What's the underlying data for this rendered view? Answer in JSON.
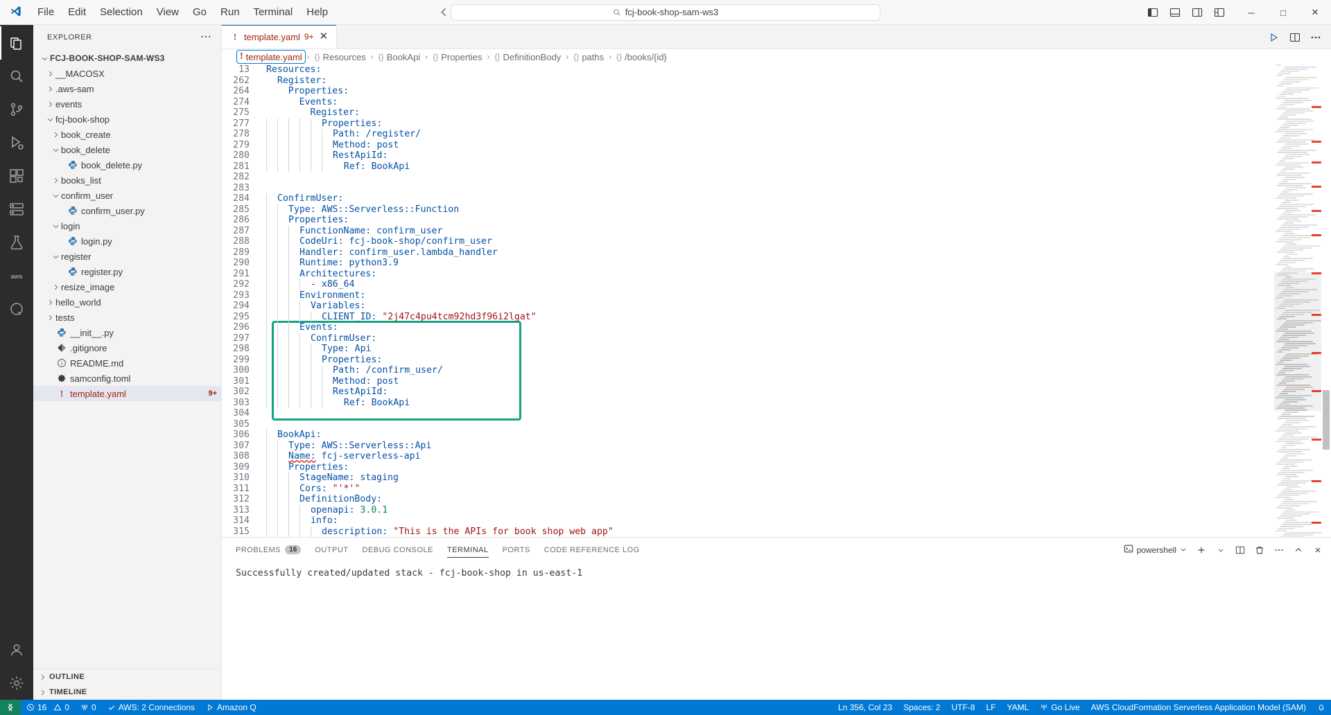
{
  "titlebar": {
    "logo_icon": "vscode-logo-icon",
    "menus": [
      "File",
      "Edit",
      "Selection",
      "View",
      "Go",
      "Run",
      "Terminal",
      "Help"
    ],
    "nav_back_icon": "arrow-left-icon",
    "nav_forward_icon": "arrow-right-icon",
    "command_center": {
      "icon": "search-icon",
      "text": "fcj-book-shop-sam-ws3"
    },
    "layout_icons": [
      "toggle-primary-sidebar-icon",
      "toggle-panel-icon",
      "toggle-secondary-sidebar-icon",
      "customize-layout-icon"
    ],
    "window_controls": {
      "minimize": "─",
      "maximize": "□",
      "close": "✕"
    }
  },
  "activitybar": {
    "items": [
      {
        "name": "explorer-icon",
        "active": true
      },
      {
        "name": "search-icon",
        "active": false
      },
      {
        "name": "source-control-icon",
        "active": false
      },
      {
        "name": "run-debug-icon",
        "active": false
      },
      {
        "name": "extensions-icon",
        "active": false
      },
      {
        "name": "remote-explorer-icon",
        "active": false
      },
      {
        "name": "testing-icon",
        "active": false
      },
      {
        "name": "aws-toolkit-icon",
        "active": false
      },
      {
        "name": "amazon-q-icon",
        "active": false
      }
    ],
    "bottom": [
      {
        "name": "accounts-icon"
      },
      {
        "name": "settings-gear-icon"
      }
    ]
  },
  "sidebar": {
    "title": "EXPLORER",
    "more_actions_icon": "ellipsis-icon",
    "tree": [
      {
        "label": "FCJ-BOOK-SHOP-SAM-WS3",
        "depth": 0,
        "type": "root",
        "state": "expanded",
        "icon": ""
      },
      {
        "label": "__MACOSX",
        "depth": 1,
        "type": "folder",
        "state": "collapsed",
        "icon": ""
      },
      {
        "label": ".aws-sam",
        "depth": 1,
        "type": "folder",
        "state": "collapsed",
        "icon": ""
      },
      {
        "label": "events",
        "depth": 1,
        "type": "folder",
        "state": "collapsed",
        "icon": ""
      },
      {
        "label": "fcj-book-shop",
        "depth": 1,
        "type": "folder",
        "state": "expanded",
        "icon": ""
      },
      {
        "label": "book_create",
        "depth": 2,
        "type": "folder",
        "state": "collapsed",
        "icon": ""
      },
      {
        "label": "book_delete",
        "depth": 2,
        "type": "folder",
        "state": "expanded",
        "icon": ""
      },
      {
        "label": "book_delete.py",
        "depth": 3,
        "type": "file",
        "state": "none",
        "icon": "python-icon"
      },
      {
        "label": "books_list",
        "depth": 2,
        "type": "folder",
        "state": "collapsed",
        "icon": ""
      },
      {
        "label": "confirm_user",
        "depth": 2,
        "type": "folder",
        "state": "expanded",
        "icon": ""
      },
      {
        "label": "confirm_user.py",
        "depth": 3,
        "type": "file",
        "state": "none",
        "icon": "python-icon"
      },
      {
        "label": "login",
        "depth": 2,
        "type": "folder",
        "state": "expanded",
        "icon": ""
      },
      {
        "label": "login.py",
        "depth": 3,
        "type": "file",
        "state": "none",
        "icon": "python-icon"
      },
      {
        "label": "register",
        "depth": 2,
        "type": "folder",
        "state": "expanded",
        "icon": ""
      },
      {
        "label": "register.py",
        "depth": 3,
        "type": "file",
        "state": "none",
        "icon": "python-icon"
      },
      {
        "label": "resize_image",
        "depth": 2,
        "type": "folder",
        "state": "collapsed",
        "icon": ""
      },
      {
        "label": "hello_world",
        "depth": 1,
        "type": "folder",
        "state": "collapsed",
        "icon": ""
      },
      {
        "label": "tests",
        "depth": 1,
        "type": "folder",
        "state": "collapsed",
        "icon": ""
      },
      {
        "label": "__init__.py",
        "depth": 1,
        "type": "file",
        "state": "none",
        "icon": "python-icon"
      },
      {
        "label": ".gitignore",
        "depth": 1,
        "type": "file",
        "state": "none",
        "icon": "git-icon"
      },
      {
        "label": "README.md",
        "depth": 1,
        "type": "file",
        "state": "none",
        "icon": "info-icon"
      },
      {
        "label": "samconfig.toml",
        "depth": 1,
        "type": "file",
        "state": "none",
        "icon": "gear-icon"
      },
      {
        "label": "template.yaml",
        "depth": 1,
        "type": "file",
        "state": "none",
        "icon": "warning-icon",
        "selected": true,
        "error": true,
        "badge": "9+"
      }
    ],
    "sections": [
      {
        "label": "OUTLINE",
        "state": "collapsed"
      },
      {
        "label": "TIMELINE",
        "state": "collapsed"
      }
    ]
  },
  "editor": {
    "tab": {
      "icon": "warning-icon",
      "name": "template.yaml",
      "badge": "9+",
      "close": "✕"
    },
    "tab_actions": [
      "split-editor-icon",
      "more-actions-icon",
      "run-icon"
    ],
    "breadcrumb": [
      {
        "sym": "!",
        "text": "template.yaml",
        "boxed": true,
        "error": true
      },
      {
        "sym": "{}",
        "text": "Resources"
      },
      {
        "sym": "{}",
        "text": "BookApi"
      },
      {
        "sym": "{}",
        "text": "Properties"
      },
      {
        "sym": "{}",
        "text": "DefinitionBody"
      },
      {
        "sym": "{}",
        "text": "paths"
      },
      {
        "sym": "{}",
        "text": "/books/{id}"
      }
    ],
    "highlight_color": "#13a383",
    "lines": [
      {
        "n": "13",
        "ind": 0,
        "tokens": [
          {
            "t": "Resources:",
            "c": "k"
          }
        ]
      },
      {
        "n": "262",
        "ind": 0,
        "tokens": [
          {
            "t": "  Register:",
            "c": "k"
          }
        ]
      },
      {
        "n": "264",
        "ind": 0,
        "tokens": [
          {
            "t": "    Properties:",
            "c": "k"
          }
        ]
      },
      {
        "n": "274",
        "ind": 0,
        "tokens": [
          {
            "t": "      Events:",
            "c": "k"
          }
        ]
      },
      {
        "n": "275",
        "ind": 0,
        "tokens": [
          {
            "t": "        Register:",
            "c": "k"
          }
        ]
      },
      {
        "n": "277",
        "ind": 5,
        "tokens": [
          {
            "t": "          Properties:",
            "c": "k"
          }
        ]
      },
      {
        "n": "278",
        "ind": 6,
        "tokens": [
          {
            "t": "            Path:",
            "c": "k"
          },
          {
            "t": " /register/",
            "c": "v"
          }
        ]
      },
      {
        "n": "279",
        "ind": 6,
        "tokens": [
          {
            "t": "            Method:",
            "c": "k"
          },
          {
            "t": " post",
            "c": "v"
          }
        ]
      },
      {
        "n": "280",
        "ind": 6,
        "tokens": [
          {
            "t": "            RestApiId:",
            "c": "k"
          }
        ]
      },
      {
        "n": "281",
        "ind": 6,
        "tokens": [
          {
            "t": "              Ref:",
            "c": "k"
          },
          {
            "t": " BookApi",
            "c": "v"
          }
        ]
      },
      {
        "n": "282",
        "ind": 0,
        "tokens": []
      },
      {
        "n": "283",
        "ind": 0,
        "tokens": []
      },
      {
        "n": "284",
        "ind": 1,
        "tokens": [
          {
            "t": "  ConfirmUser:",
            "c": "k"
          }
        ]
      },
      {
        "n": "285",
        "ind": 2,
        "tokens": [
          {
            "t": "    Type:",
            "c": "k"
          },
          {
            "t": " AWS::Serverless::Function",
            "c": "v"
          }
        ]
      },
      {
        "n": "286",
        "ind": 2,
        "tokens": [
          {
            "t": "    Properties:",
            "c": "k"
          }
        ]
      },
      {
        "n": "287",
        "ind": 3,
        "tokens": [
          {
            "t": "      FunctionName:",
            "c": "k"
          },
          {
            "t": " confirm_user",
            "c": "v"
          }
        ]
      },
      {
        "n": "288",
        "ind": 3,
        "tokens": [
          {
            "t": "      CodeUri:",
            "c": "k"
          },
          {
            "t": " fcj-book-shop/confirm_user",
            "c": "v"
          }
        ]
      },
      {
        "n": "289",
        "ind": 3,
        "tokens": [
          {
            "t": "      Handler:",
            "c": "k"
          },
          {
            "t": " confirm_user.lambda_handler",
            "c": "v"
          }
        ]
      },
      {
        "n": "290",
        "ind": 3,
        "tokens": [
          {
            "t": "      Runtime:",
            "c": "k"
          },
          {
            "t": " python3.9",
            "c": "v"
          }
        ]
      },
      {
        "n": "291",
        "ind": 3,
        "tokens": [
          {
            "t": "      Architectures:",
            "c": "k"
          }
        ]
      },
      {
        "n": "292",
        "ind": 4,
        "tokens": [
          {
            "t": "        - ",
            "c": "p"
          },
          {
            "t": "x86_64",
            "c": "v"
          }
        ]
      },
      {
        "n": "293",
        "ind": 3,
        "tokens": [
          {
            "t": "      Environment:",
            "c": "k"
          }
        ]
      },
      {
        "n": "294",
        "ind": 4,
        "tokens": [
          {
            "t": "        Variables:",
            "c": "k"
          }
        ]
      },
      {
        "n": "295",
        "ind": 5,
        "tokens": [
          {
            "t": "          CLIENT_ID:",
            "c": "k"
          },
          {
            "t": " \"2j47c4pu4tcm92hd3f96i2lgat\"",
            "c": "s"
          }
        ]
      },
      {
        "n": "296",
        "ind": 3,
        "tokens": [
          {
            "t": "      Events:",
            "c": "k"
          }
        ]
      },
      {
        "n": "297",
        "ind": 4,
        "tokens": [
          {
            "t": "        ConfirmUser:",
            "c": "k"
          }
        ]
      },
      {
        "n": "298",
        "ind": 5,
        "tokens": [
          {
            "t": "          Type:",
            "c": "k"
          },
          {
            "t": " Api",
            "c": "v"
          }
        ]
      },
      {
        "n": "299",
        "ind": 5,
        "tokens": [
          {
            "t": "          Properties:",
            "c": "k"
          }
        ]
      },
      {
        "n": "300",
        "ind": 6,
        "tokens": [
          {
            "t": "            Path:",
            "c": "k"
          },
          {
            "t": " /confirm_user/",
            "c": "v"
          }
        ]
      },
      {
        "n": "301",
        "ind": 6,
        "tokens": [
          {
            "t": "            Method:",
            "c": "k"
          },
          {
            "t": " post",
            "c": "v"
          }
        ]
      },
      {
        "n": "302",
        "ind": 6,
        "tokens": [
          {
            "t": "            RestApiId:",
            "c": "k"
          }
        ]
      },
      {
        "n": "303",
        "ind": 6,
        "tokens": [
          {
            "t": "              Ref:",
            "c": "k"
          },
          {
            "t": " BookApi",
            "c": "v"
          }
        ]
      },
      {
        "n": "304",
        "ind": 0,
        "tokens": []
      },
      {
        "n": "305",
        "ind": 0,
        "tokens": []
      },
      {
        "n": "306",
        "ind": 1,
        "tokens": [
          {
            "t": "  BookApi:",
            "c": "k"
          }
        ]
      },
      {
        "n": "307",
        "ind": 2,
        "tokens": [
          {
            "t": "    Type:",
            "c": "k"
          },
          {
            "t": " AWS::Serverless::Api",
            "c": "v"
          }
        ]
      },
      {
        "n": "308",
        "ind": 2,
        "tokens": [
          {
            "t": "    Name:",
            "c": "k squig"
          },
          {
            "t": " fcj-serverless-api",
            "c": "v"
          }
        ]
      },
      {
        "n": "309",
        "ind": 2,
        "tokens": [
          {
            "t": "    Properties:",
            "c": "k"
          }
        ]
      },
      {
        "n": "310",
        "ind": 3,
        "tokens": [
          {
            "t": "      StageName:",
            "c": "k"
          },
          {
            "t": " staging",
            "c": "v"
          }
        ]
      },
      {
        "n": "311",
        "ind": 3,
        "tokens": [
          {
            "t": "      Cors:",
            "c": "k"
          },
          {
            "t": " \"'*'\"",
            "c": "s"
          }
        ]
      },
      {
        "n": "312",
        "ind": 3,
        "tokens": [
          {
            "t": "      DefinitionBody:",
            "c": "k"
          }
        ]
      },
      {
        "n": "313",
        "ind": 4,
        "tokens": [
          {
            "t": "        openapi:",
            "c": "k"
          },
          {
            "t": " 3.0.1",
            "c": "n"
          }
        ]
      },
      {
        "n": "314",
        "ind": 4,
        "tokens": [
          {
            "t": "        info:",
            "c": "k"
          }
        ]
      },
      {
        "n": "315",
        "ind": 5,
        "tokens": [
          {
            "t": "          description:",
            "c": "k"
          },
          {
            "t": " \"This is the APIs for book shop web app\"",
            "c": "s"
          }
        ]
      }
    ]
  },
  "panel": {
    "tabs": [
      {
        "label": "PROBLEMS",
        "count": "16",
        "active": false
      },
      {
        "label": "OUTPUT",
        "count": "",
        "active": false
      },
      {
        "label": "DEBUG CONSOLE",
        "count": "",
        "active": false
      },
      {
        "label": "TERMINAL",
        "count": "",
        "active": true
      },
      {
        "label": "PORTS",
        "count": "",
        "active": false
      },
      {
        "label": "CODE REFERENCE LOG",
        "count": "",
        "active": false
      }
    ],
    "shell": {
      "icon": "terminal-icon",
      "label": "powershell",
      "chevron": "chevron-down-icon"
    },
    "actions": [
      "new-terminal-icon",
      "split-terminal-icon",
      "kill-terminal-icon",
      "more-actions-icon",
      "maximize-panel-icon",
      "close-panel-icon"
    ],
    "terminal_output": "Successfully created/updated stack - fcj-book-shop in us-east-1"
  },
  "statusbar": {
    "remote_icon": "remote-window-icon",
    "left": [
      {
        "icon": "error-icon",
        "label": "16",
        "icon2": "warning-triangle-icon",
        "label2": "0",
        "name": "problems-status"
      },
      {
        "icon": "radio-tower-icon",
        "label": "0",
        "name": "ports-status"
      },
      {
        "icon": "check-icon",
        "label": "AWS: 2 Connections",
        "name": "aws-connections-status"
      },
      {
        "icon": "play-icon",
        "label": "Amazon Q",
        "name": "amazon-q-status"
      }
    ],
    "right": [
      {
        "label": "Ln 356, Col 23",
        "name": "cursor-position-status"
      },
      {
        "label": "Spaces: 2",
        "name": "indentation-status"
      },
      {
        "label": "UTF-8",
        "name": "encoding-status"
      },
      {
        "label": "LF",
        "name": "eol-status"
      },
      {
        "label": "YAML",
        "name": "language-mode-status"
      },
      {
        "icon": "broadcast-icon",
        "label": "Go Live",
        "name": "go-live-status"
      },
      {
        "label": "AWS CloudFormation Serverless Application Model (SAM)",
        "name": "sam-status"
      },
      {
        "icon": "bell-icon",
        "label": "",
        "name": "notifications-status"
      }
    ]
  }
}
